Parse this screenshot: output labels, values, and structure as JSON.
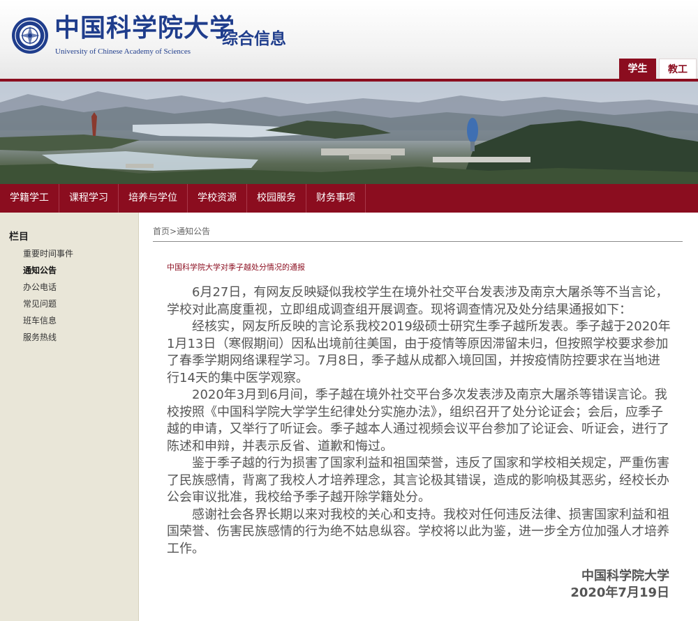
{
  "header": {
    "logo_cn": "中国科学院大学",
    "logo_en": "University of Chinese Academy of Sciences",
    "site_title": "综合信息",
    "role_tabs": [
      {
        "label": "学生",
        "active": true
      },
      {
        "label": "教工",
        "active": false
      }
    ]
  },
  "nav": {
    "items": [
      "学籍学工",
      "课程学习",
      "培养与学位",
      "学校资源",
      "校园服务",
      "财务事项"
    ]
  },
  "sidebar": {
    "heading": "栏目",
    "items": [
      "重要时间事件",
      "通知公告",
      "办公电话",
      "常见问题",
      "班车信息",
      "服务热线"
    ],
    "current": "通知公告"
  },
  "breadcrumb": {
    "home": "首页",
    "separator": ">",
    "current": "通知公告"
  },
  "article": {
    "title": "中国科学院大学对季子越处分情况的通报",
    "paragraphs": [
      "6月27日，有网友反映疑似我校学生在境外社交平台发表涉及南京大屠杀等不当言论，学校对此高度重视，立即组成调查组开展调查。现将调查情况及处分结果通报如下：",
      "经核实，网友所反映的言论系我校2019级硕士研究生季子越所发表。季子越于2020年1月13日（寒假期间）因私出境前往美国，由于疫情等原因滞留未归，但按照学校要求参加了春季学期网络课程学习。7月8日，季子越从成都入境回国，并按疫情防控要求在当地进行14天的集中医学观察。",
      "2020年3月到6月间，季子越在境外社交平台多次发表涉及南京大屠杀等错误言论。我校按照《中国科学院大学学生纪律处分实施办法》，组织召开了处分论证会；会后，应季子越的申请，又举行了听证会。季子越本人通过视频会议平台参加了论证会、听证会，进行了陈述和申辩，并表示反省、道歉和悔过。",
      "鉴于季子越的行为损害了国家利益和祖国荣誉，违反了国家和学校相关规定，严重伤害了民族感情，背离了我校人才培养理念，其言论极其错误，造成的影响极其恶劣，经校长办公会审议批准，我校给予季子越开除学籍处分。",
      "感谢社会各界长期以来对我校的关心和支持。我校对任何违反法律、损害国家利益和祖国荣誉、伤害民族感情的行为绝不姑息纵容。学校将以此为鉴，进一步全方位加强人才培养工作。"
    ],
    "signature_org": "中国科学院大学",
    "signature_date": "2020年7月19日"
  },
  "colors": {
    "brand_red": "#8b0d1f",
    "brand_blue": "#1f3d8c",
    "sidebar_bg": "#e9e6d8"
  },
  "icons": {
    "logo": "university-emblem-icon"
  }
}
